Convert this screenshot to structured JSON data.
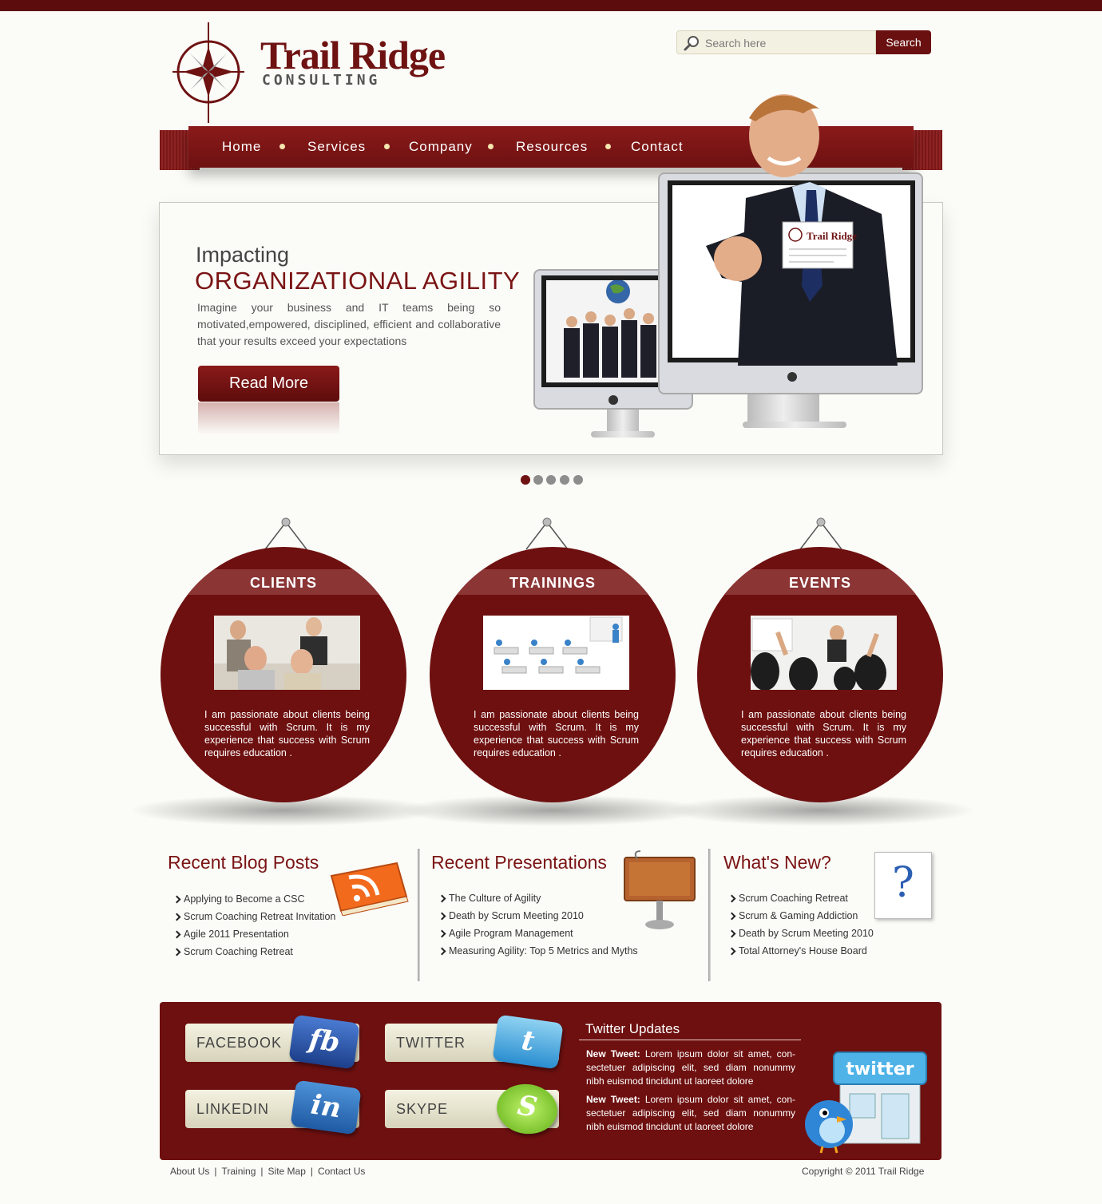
{
  "brand": {
    "name": "Trail Ridge",
    "tagline": "CONSULTING"
  },
  "search": {
    "placeholder": "Search here",
    "button_label": "Search"
  },
  "nav": {
    "items": [
      {
        "label": "Home"
      },
      {
        "label": "Services"
      },
      {
        "label": "Company"
      },
      {
        "label": "Resources"
      },
      {
        "label": "Contact"
      }
    ]
  },
  "hero": {
    "kicker": "Impacting",
    "title": "ORGANIZATIONAL AGILITY",
    "body": "Imagine your business and IT teams being so motivated,empowered, disciplined, efficient and collaborative that your results exceed your expectations",
    "button_label": "Read More",
    "card_text": "Trail Ridge",
    "slides_total": 5,
    "active_slide": 1
  },
  "features": [
    {
      "title": "CLIENTS",
      "text": "I am passionate about clients being successful with Scrum. It is my experience that success with Scrum requires education ."
    },
    {
      "title": "TRAININGS",
      "text": "I am passionate about clients being successful with Scrum. It is my experience that success with Scrum requires education ."
    },
    {
      "title": "EVENTS",
      "text": "I am passionate about clients being successful with Scrum. It is my experience that success with Scrum requires education ."
    }
  ],
  "blog": {
    "title": "Recent Blog Posts",
    "items": [
      "Applying to Become a CSC",
      "Scrum Coaching Retreat Invitation",
      "Agile 2011 Presentation",
      "Scrum Coaching Retreat"
    ]
  },
  "presentations": {
    "title": "Recent Presentations",
    "items": [
      "The Culture of Agility",
      "Death by Scrum Meeting 2010",
      "Agile Program Management",
      "Measuring Agility: Top 5 Metrics and Myths"
    ]
  },
  "whats_new": {
    "title": "What's New?",
    "icon_glyph": "?",
    "items": [
      "Scrum Coaching Retreat",
      "Scrum & Gaming Addiction",
      "Death by Scrum Meeting 2010",
      "Total Attorney's House Board"
    ]
  },
  "social": {
    "facebook": {
      "label": "FACEBOOK",
      "glyph": "fb"
    },
    "twitter": {
      "label": "TWITTER",
      "glyph": "t"
    },
    "linkedin": {
      "label": "LINKEDIN",
      "glyph": "in"
    },
    "skype": {
      "label": "SKYPE",
      "glyph": "S"
    }
  },
  "twitter_updates": {
    "title": "Twitter Updates",
    "store_sign": "twitter",
    "tweets": [
      {
        "label": "New Tweet:",
        "text": " Lorem ipsum dolor sit amet, con-sectetuer adipiscing elit, sed diam nonummy nibh euismod tincidunt ut laoreet dolore"
      },
      {
        "label": "New Tweet:",
        "text": " Lorem ipsum dolor sit amet, con-sectetuer adipiscing elit, sed diam nonummy nibh euismod tincidunt ut laoreet dolore"
      }
    ]
  },
  "footer": {
    "links": [
      "About Us",
      "Training",
      "Site Map",
      "Contact Us"
    ],
    "separator": "|",
    "copyright": "Copyright © 2011 Trail Ridge"
  },
  "colors": {
    "brand": "#6e1010",
    "accent_dot": "#f5e6b0",
    "background": "#fbfbf7"
  }
}
